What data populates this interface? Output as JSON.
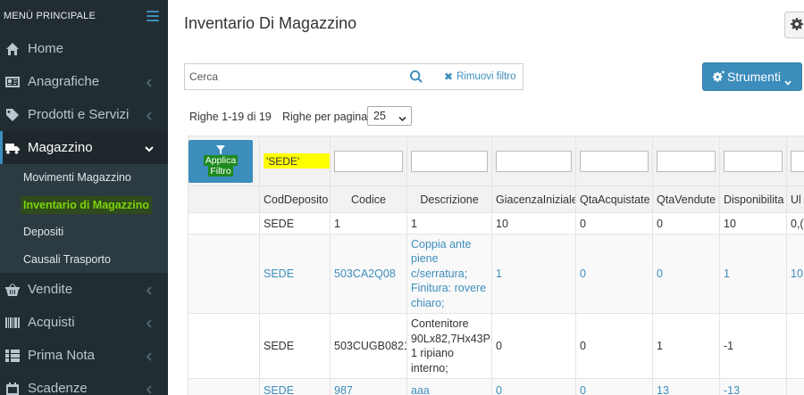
{
  "sidebar": {
    "menu_title": "MENÙ PRINCIPALE",
    "items": [
      {
        "label": "Home",
        "icon": "home-icon"
      },
      {
        "label": "Anagrafiche",
        "icon": "address-card-icon"
      },
      {
        "label": "Prodotti e Servizi",
        "icon": "tag-icon"
      },
      {
        "label": "Magazzino",
        "icon": "truck-icon"
      },
      {
        "label": "Vendite",
        "icon": "basket-icon"
      },
      {
        "label": "Acquisti",
        "icon": "barcode-icon"
      },
      {
        "label": "Prima Nota",
        "icon": "list-icon"
      },
      {
        "label": "Scadenze",
        "icon": "calendar-icon"
      }
    ],
    "submenu": [
      {
        "label": "Movimenti Magazzino"
      },
      {
        "label": "Inventario di Magazzino"
      },
      {
        "label": "Depositi"
      },
      {
        "label": "Causali Trasporto"
      }
    ]
  },
  "header": {
    "title": "Inventario Di Magazzino"
  },
  "toolbar": {
    "search_placeholder": "Cerca",
    "remove_filter_label": "Rimuovi filtro",
    "tools_label": "Strumenti",
    "rows_info": "Righe 1-19 di 19",
    "rows_per_page_label": "Righe per pagina",
    "rows_per_page_value": "25"
  },
  "table": {
    "apply_filter_line1": "Applica",
    "apply_filter_line2": "Filtro",
    "filter_value": "'SEDE'",
    "columns": [
      "CodDeposito",
      "Codice",
      "Descrizione",
      "GiacenzaIniziale",
      "QtaAcquistate",
      "QtaVendute",
      "Disponibilita",
      "Ul"
    ],
    "rows": [
      {
        "dep": "SEDE",
        "code": "1",
        "desc": [
          "1"
        ],
        "giac": "10",
        "acq": "0",
        "ven": "0",
        "disp": "10",
        "ul": "0,("
      },
      {
        "dep": "SEDE",
        "code": "503CA2Q08",
        "desc": [
          "Coppia ante",
          "piene",
          "c/serratura;",
          "Finitura: rovere",
          "chiaro;"
        ],
        "giac": "1",
        "acq": "0",
        "ven": "0",
        "disp": "1",
        "ul": "10"
      },
      {
        "dep": "SEDE",
        "code": "503CUGB0821",
        "desc": [
          "Contenitore",
          "90Lx82,7Hx43P;",
          "1 ripiano",
          "interno;"
        ],
        "giac": "0",
        "acq": "0",
        "ven": "1",
        "disp": "-1",
        "ul": ""
      },
      {
        "dep": "SEDE",
        "code": "987",
        "desc": [
          "aaa"
        ],
        "giac": "0",
        "acq": "0",
        "ven": "13",
        "disp": "-13",
        "ul": ""
      }
    ]
  },
  "colors": {
    "accent": "#3c8dbc",
    "sidebar_bg": "#222d32",
    "highlight": "#ffff00",
    "active_sub": "#7cd40a"
  }
}
